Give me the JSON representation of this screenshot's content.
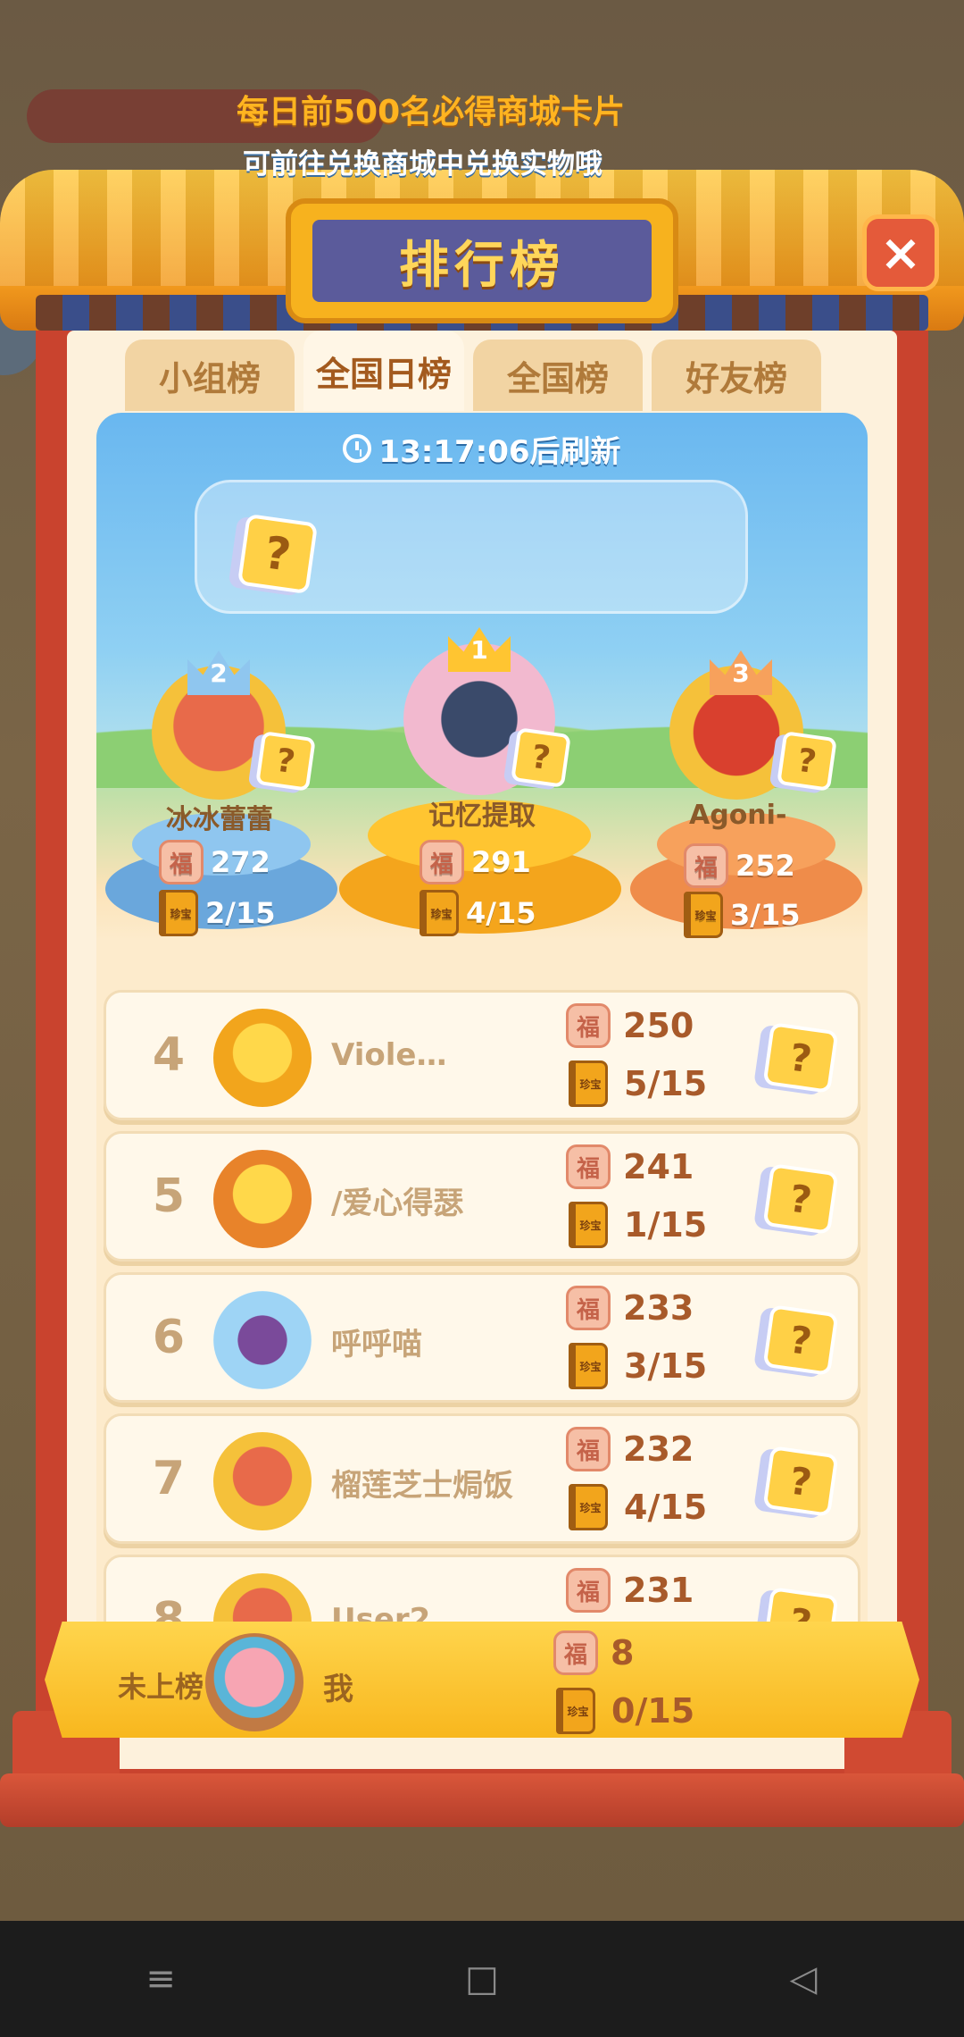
{
  "title": "排行榜",
  "close_label": "×",
  "tabs": [
    {
      "label": "小组榜",
      "active": false
    },
    {
      "label": "全国日榜",
      "active": true
    },
    {
      "label": "全国榜",
      "active": false
    },
    {
      "label": "好友榜",
      "active": false
    }
  ],
  "refresh": "13:17:06后刷新",
  "notice": {
    "line1": "每日前500名必得商城卡片",
    "line2": "可前往兑换商城中兑换实物哦"
  },
  "icons": {
    "fu": "福",
    "book": "珍宝",
    "mystery": "?"
  },
  "podium": [
    {
      "rank": "1",
      "name": "记忆提取",
      "score": "291",
      "books": "4/15",
      "color": "#ffc531"
    },
    {
      "rank": "2",
      "name": "冰冰蕾蕾",
      "score": "272",
      "books": "2/15",
      "color": "#8fc6ef"
    },
    {
      "rank": "3",
      "name": "Agoni-",
      "score": "252",
      "books": "3/15",
      "color": "#f7a15c"
    }
  ],
  "list": [
    {
      "rank": "4",
      "name": "Viole…",
      "score": "250",
      "books": "5/15"
    },
    {
      "rank": "5",
      "name": "/爱心得瑟",
      "score": "241",
      "books": "1/15"
    },
    {
      "rank": "6",
      "name": "呼呼喵",
      "score": "233",
      "books": "3/15"
    },
    {
      "rank": "7",
      "name": "榴莲芝士焗饭",
      "score": "232",
      "books": "4/15"
    },
    {
      "rank": "8",
      "name": "User2",
      "score": "231",
      "books": ""
    }
  ],
  "me": {
    "status": "未上榜",
    "name": "我",
    "score": "8",
    "books": "0/15"
  },
  "nav": {
    "menu": "≡",
    "home": "□",
    "back": "◁"
  }
}
